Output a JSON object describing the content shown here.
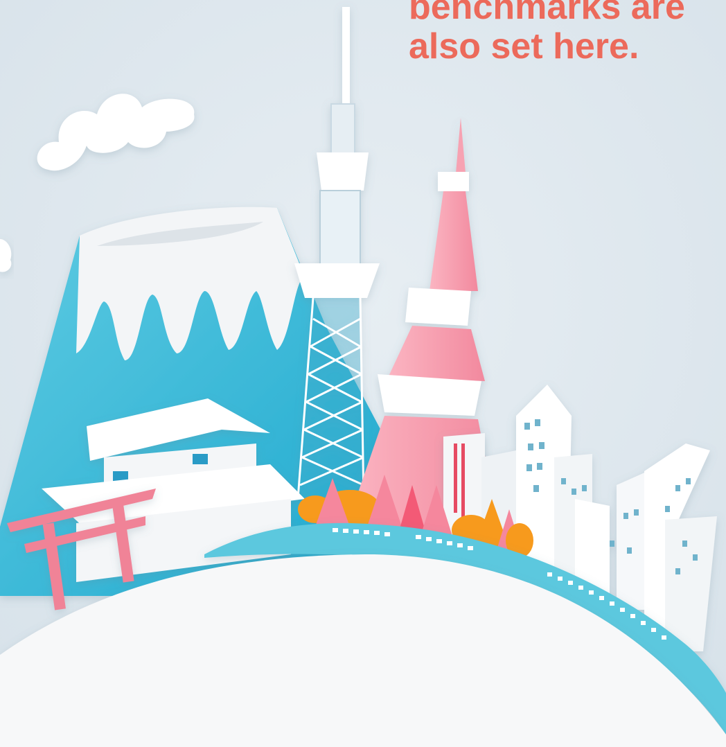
{
  "headline": {
    "lines": [
      "benchmarks are",
      "also set here."
    ],
    "color": "#ec6a5b"
  },
  "palette": {
    "sky": "#dde7ee",
    "cloud": "#ffffff",
    "mountain": "#4ec3dc",
    "snow": "#f2f4f6",
    "skytree": "#ffffff",
    "tokyo_tower": "#f7a2b2",
    "torii": "#f08397",
    "train": "#5bc8de",
    "globe": "#f7f8f9",
    "foliage_orange": "#f79a1d",
    "foliage_pink": "#f5879d"
  },
  "icons": [
    "cloud-icon",
    "mount-fuji-icon",
    "tokyo-skytree-icon",
    "tokyo-tower-icon",
    "torii-gate-icon",
    "castle-icon",
    "city-buildings-icon",
    "bullet-train-icon",
    "trees-icon",
    "globe-icon"
  ]
}
